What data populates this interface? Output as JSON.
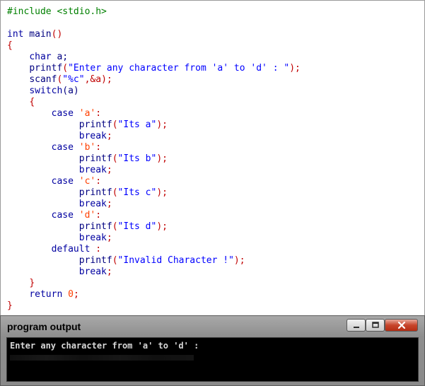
{
  "code": {
    "lines": [
      [
        {
          "t": "#include <stdio.h>",
          "c": "pp"
        }
      ],
      [],
      [
        {
          "t": "int",
          "c": "kw"
        },
        {
          "t": " main",
          "c": "id"
        },
        {
          "t": "()",
          "c": "op"
        }
      ],
      [
        {
          "t": "{",
          "c": "op"
        }
      ],
      [
        {
          "t": "    ",
          "c": "plain"
        },
        {
          "t": "char",
          "c": "kw"
        },
        {
          "t": " a;",
          "c": "id"
        }
      ],
      [
        {
          "t": "    ",
          "c": "plain"
        },
        {
          "t": "printf",
          "c": "id"
        },
        {
          "t": "(",
          "c": "op"
        },
        {
          "t": "\"Enter any character from 'a' to 'd' : \"",
          "c": "str"
        },
        {
          "t": ");",
          "c": "op"
        }
      ],
      [
        {
          "t": "    ",
          "c": "plain"
        },
        {
          "t": "scanf",
          "c": "id"
        },
        {
          "t": "(",
          "c": "op"
        },
        {
          "t": "\"%c\"",
          "c": "str"
        },
        {
          "t": ",&a);",
          "c": "op"
        }
      ],
      [
        {
          "t": "    ",
          "c": "plain"
        },
        {
          "t": "switch",
          "c": "kw"
        },
        {
          "t": "(a)",
          "c": "id"
        }
      ],
      [
        {
          "t": "    ",
          "c": "plain"
        },
        {
          "t": "{",
          "c": "op"
        }
      ],
      [
        {
          "t": "        ",
          "c": "plain"
        },
        {
          "t": "case",
          "c": "kw"
        },
        {
          "t": " 'a'",
          "c": "num"
        },
        {
          "t": ":",
          "c": "op"
        }
      ],
      [
        {
          "t": "             ",
          "c": "plain"
        },
        {
          "t": "printf",
          "c": "id"
        },
        {
          "t": "(",
          "c": "op"
        },
        {
          "t": "\"Its a\"",
          "c": "str"
        },
        {
          "t": ");",
          "c": "op"
        }
      ],
      [
        {
          "t": "             ",
          "c": "plain"
        },
        {
          "t": "break",
          "c": "kw"
        },
        {
          "t": ";",
          "c": "op"
        }
      ],
      [
        {
          "t": "        ",
          "c": "plain"
        },
        {
          "t": "case",
          "c": "kw"
        },
        {
          "t": " 'b'",
          "c": "num"
        },
        {
          "t": ":",
          "c": "op"
        }
      ],
      [
        {
          "t": "             ",
          "c": "plain"
        },
        {
          "t": "printf",
          "c": "id"
        },
        {
          "t": "(",
          "c": "op"
        },
        {
          "t": "\"Its b\"",
          "c": "str"
        },
        {
          "t": ");",
          "c": "op"
        }
      ],
      [
        {
          "t": "             ",
          "c": "plain"
        },
        {
          "t": "break",
          "c": "kw"
        },
        {
          "t": ";",
          "c": "op"
        }
      ],
      [
        {
          "t": "        ",
          "c": "plain"
        },
        {
          "t": "case",
          "c": "kw"
        },
        {
          "t": " 'c'",
          "c": "num"
        },
        {
          "t": ":",
          "c": "op"
        }
      ],
      [
        {
          "t": "             ",
          "c": "plain"
        },
        {
          "t": "printf",
          "c": "id"
        },
        {
          "t": "(",
          "c": "op"
        },
        {
          "t": "\"Its c\"",
          "c": "str"
        },
        {
          "t": ");",
          "c": "op"
        }
      ],
      [
        {
          "t": "             ",
          "c": "plain"
        },
        {
          "t": "break",
          "c": "kw"
        },
        {
          "t": ";",
          "c": "op"
        }
      ],
      [
        {
          "t": "        ",
          "c": "plain"
        },
        {
          "t": "case",
          "c": "kw"
        },
        {
          "t": " 'd'",
          "c": "num"
        },
        {
          "t": ":",
          "c": "op"
        }
      ],
      [
        {
          "t": "             ",
          "c": "plain"
        },
        {
          "t": "printf",
          "c": "id"
        },
        {
          "t": "(",
          "c": "op"
        },
        {
          "t": "\"Its d\"",
          "c": "str"
        },
        {
          "t": ");",
          "c": "op"
        }
      ],
      [
        {
          "t": "             ",
          "c": "plain"
        },
        {
          "t": "break",
          "c": "kw"
        },
        {
          "t": ";",
          "c": "op"
        }
      ],
      [
        {
          "t": "        ",
          "c": "plain"
        },
        {
          "t": "default",
          "c": "kw"
        },
        {
          "t": " :",
          "c": "op"
        }
      ],
      [
        {
          "t": "             ",
          "c": "plain"
        },
        {
          "t": "printf",
          "c": "id"
        },
        {
          "t": "(",
          "c": "op"
        },
        {
          "t": "\"Invalid Character !\"",
          "c": "str"
        },
        {
          "t": ");",
          "c": "op"
        }
      ],
      [
        {
          "t": "             ",
          "c": "plain"
        },
        {
          "t": "break",
          "c": "kw"
        },
        {
          "t": ";",
          "c": "op"
        }
      ],
      [
        {
          "t": "    ",
          "c": "plain"
        },
        {
          "t": "}",
          "c": "op"
        }
      ],
      [
        {
          "t": "    ",
          "c": "plain"
        },
        {
          "t": "return",
          "c": "kw"
        },
        {
          "t": " 0",
          "c": "num"
        },
        {
          "t": ";",
          "c": "op"
        }
      ],
      [
        {
          "t": "}",
          "c": "op"
        }
      ]
    ]
  },
  "console": {
    "title": "program output",
    "output_line": "Enter any character from 'a' to 'd' :",
    "min_icon": "minimize-icon",
    "max_icon": "maximize-icon",
    "close_icon": "close-icon"
  },
  "colors": {
    "keyword": "#0000a0",
    "string": "#0000ff",
    "preprocessor": "#008000",
    "number": "#ff4000",
    "close_button": "#c7442a",
    "console_bg": "#000000"
  }
}
